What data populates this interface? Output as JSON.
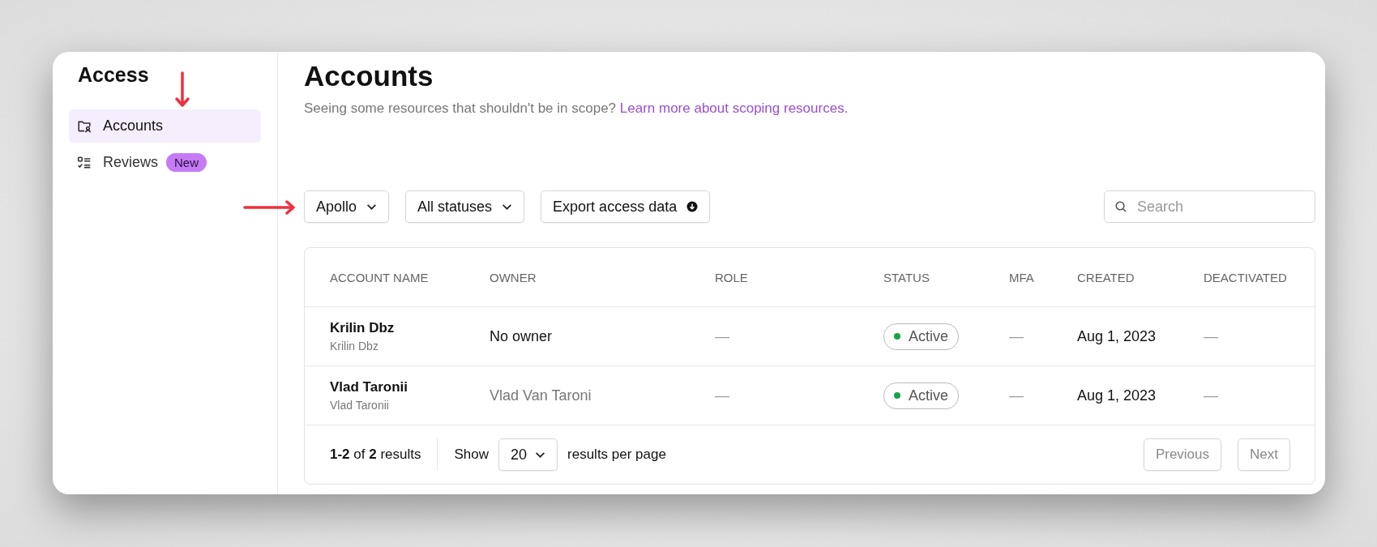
{
  "sidebar": {
    "title": "Access",
    "items": [
      {
        "label": "Accounts",
        "selected": true
      },
      {
        "label": "Reviews",
        "selected": false,
        "badge": "New"
      }
    ]
  },
  "page": {
    "title": "Accounts",
    "subtitle": "Seeing some resources that shouldn't be in scope?",
    "link": "Learn more about scoping resources."
  },
  "toolbar": {
    "filters": [
      {
        "label": "Apollo",
        "kind": "dropdown"
      },
      {
        "label": "All statuses",
        "kind": "dropdown"
      },
      {
        "label": "Export access data",
        "kind": "export"
      }
    ],
    "search": {
      "placeholder": "Search"
    }
  },
  "table": {
    "columns": [
      "ACCOUNT NAME",
      "OWNER",
      "ROLE",
      "STATUS",
      "MFA",
      "CREATED",
      "DEACTIVATED"
    ],
    "rows": [
      {
        "name": "Krilin Dbz",
        "subname": "Krilin Dbz",
        "owner": "No owner",
        "owner_muted": false,
        "role": "—",
        "status": "Active",
        "color": "#16a34a",
        "mfa": "—",
        "created": "Aug 1, 2023",
        "deactivated": "—"
      },
      {
        "name": "Vlad Taronii",
        "subname": "Vlad Taronii",
        "owner": "Vlad Van Taroni",
        "owner_muted": true,
        "role": "—",
        "status": "Active",
        "color": "#16a34a",
        "mfa": "—",
        "created": "Aug 1, 2023",
        "deactivated": "—"
      }
    ]
  },
  "pagination": {
    "summary": "**1-2** of **2** results",
    "show_label": "Show",
    "page_size": "20",
    "per_page_label": "results per page",
    "buttons": [
      {
        "label": "Previous",
        "disabled": true
      },
      {
        "label": "Next",
        "disabled": true
      }
    ]
  }
}
